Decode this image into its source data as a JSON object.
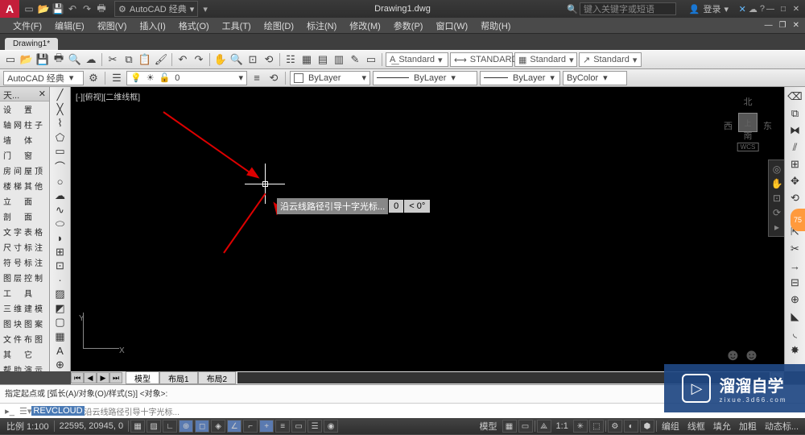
{
  "title": "Drawing1.dwg",
  "app_letter": "A",
  "workspace": "AutoCAD 经典",
  "search_placeholder": "键入关键字或短语",
  "login": "登录",
  "menus": [
    "文件(F)",
    "编辑(E)",
    "视图(V)",
    "插入(I)",
    "格式(O)",
    "工具(T)",
    "绘图(D)",
    "标注(N)",
    "修改(M)",
    "参数(P)",
    "窗口(W)",
    "帮助(H)"
  ],
  "doc_tab": "Drawing1*",
  "style_dd": {
    "text": "Standard",
    "dim": "STANDARD",
    "table": "Standard",
    "ml": "Standard"
  },
  "prop": {
    "ws": "AutoCAD 经典",
    "layer": "0",
    "bylayer": "ByLayer",
    "bycolor": "ByColor"
  },
  "panel_title": "天...",
  "panel_items": [
    "设　置",
    "轴网柱子",
    "墙　体",
    "门　窗",
    "房间屋顶",
    "楼梯其他",
    "立　面",
    "剖　面",
    "文字表格",
    "尺寸标注",
    "符号标注",
    "图层控制",
    "工　具",
    "三维建模",
    "图块图案",
    "文件布图",
    "其　它",
    "帮助演示"
  ],
  "view_label": "[-][俯视][二维线框]",
  "dyn_prompt": "沿云线路径引导十字光标...",
  "dyn_val": "0",
  "dyn_ang": "< 0°",
  "viewcube": {
    "n": "北",
    "s": "南",
    "e": "东",
    "w": "西",
    "top": "上",
    "wcs": "WCS"
  },
  "layout_tabs": [
    "模型",
    "布局1",
    "布局2"
  ],
  "cmd_hist": "指定起点或 [弧长(A)/对象(O)/样式(S)] <对象>:",
  "cmd_prefix": "REVCLOUD",
  "cmd_rest": " 沿云线路径引导十字光标...",
  "status": {
    "scale": "比例 1:100",
    "coords": "22595, 20945, 0",
    "model": "模型",
    "anno": "1:1",
    "right": [
      "编组",
      "线框",
      "填允",
      "加粗",
      "动态标..."
    ]
  },
  "watermark": {
    "brand": "溜溜自学",
    "sub": "zixue.3d66.com"
  },
  "help_badge": "75"
}
